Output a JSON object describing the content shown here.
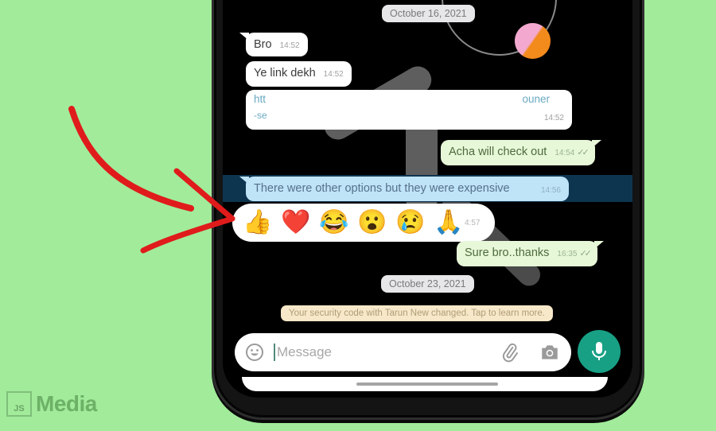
{
  "chat": {
    "date_chips": [
      "October 16, 2021",
      "October 23, 2021"
    ],
    "messages": [
      {
        "id": "m1",
        "direction": "incoming",
        "text": "Bro",
        "time": "14:52"
      },
      {
        "id": "m2",
        "direction": "incoming",
        "text": "Ye link dekh",
        "time": "14:52"
      },
      {
        "id": "m3",
        "direction": "incoming",
        "type": "link",
        "line1_start": "htt",
        "line1_end": "ouner",
        "line2": "-se",
        "time": "14:52"
      },
      {
        "id": "m4",
        "direction": "outgoing",
        "text": "Acha will check out",
        "time": "14:54",
        "status": "read"
      },
      {
        "id": "m5",
        "direction": "incoming",
        "text": "There were other options but they were expensive",
        "time": "14:56",
        "selected": true
      },
      {
        "id": "m6",
        "direction": "outgoing",
        "text": "Sure bro..thanks",
        "time": "16:35",
        "status": "read"
      }
    ],
    "reaction_bar": {
      "reactions": [
        {
          "name": "thumbs-up",
          "glyph": "👍"
        },
        {
          "name": "red-heart",
          "glyph": "❤️"
        },
        {
          "name": "tears-of-joy",
          "glyph": "😂"
        },
        {
          "name": "surprised",
          "glyph": "😮"
        },
        {
          "name": "crying",
          "glyph": "😢"
        },
        {
          "name": "folded-hands",
          "glyph": "🙏"
        }
      ],
      "partial_time": "4:57"
    },
    "security_notice": "Your security code with Tarun New changed. Tap to learn more.",
    "read_ticks": "✓✓"
  },
  "composer": {
    "placeholder": "Message",
    "value": "",
    "icons": [
      "emoji-icon",
      "attach-icon",
      "camera-icon",
      "mic-icon"
    ]
  },
  "annotation": {
    "arrow_color": "#e01b1b"
  },
  "colors": {
    "background": "#a1eb9a",
    "accent_green": "#18a085",
    "outgoing_bubble": "#e7f8d8",
    "selected_bubble": "#bfe3f7",
    "selection_band": "#0e3550"
  },
  "watermark": {
    "box_text": "JS",
    "text": "Media"
  }
}
